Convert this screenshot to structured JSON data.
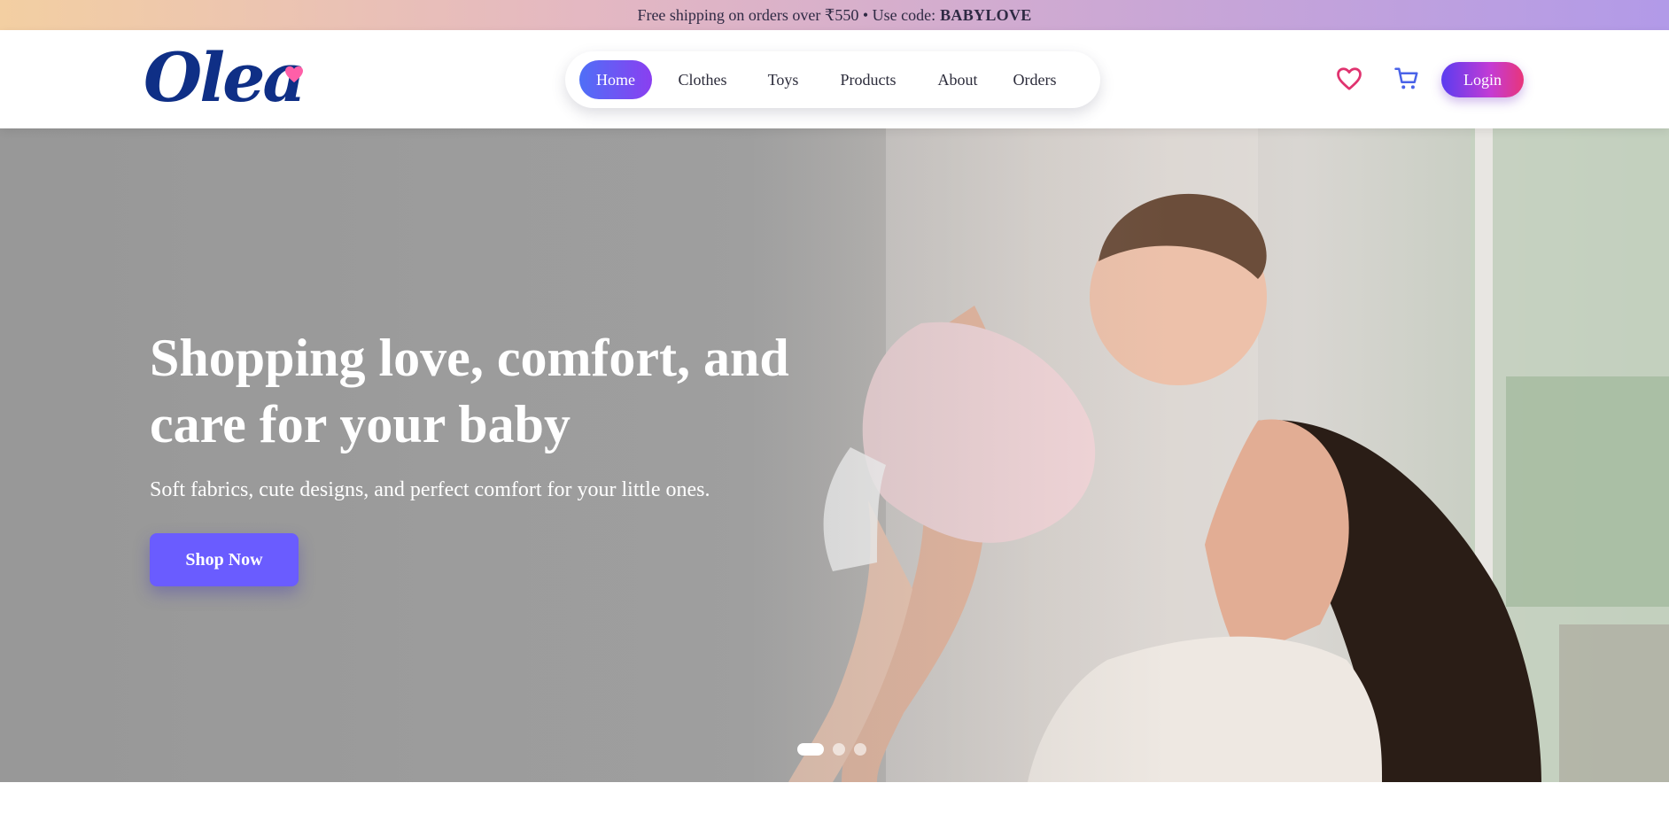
{
  "promo": {
    "text": "Free shipping on orders over ₹550 • Use code:",
    "code": "BABYLOVE"
  },
  "brand": {
    "logo_text": "Olea",
    "logo_color": "#0f2f86",
    "heart_color": "#ff5fa8"
  },
  "nav": {
    "items": [
      {
        "label": "Home",
        "active": true
      },
      {
        "label": "Clothes"
      },
      {
        "label": "Toys"
      },
      {
        "label": "Products"
      },
      {
        "label": "About"
      },
      {
        "label": "Orders"
      }
    ]
  },
  "header_actions": {
    "wishlist_icon": "heart-outline-icon",
    "cart_icon": "shopping-cart-icon",
    "login_label": "Login"
  },
  "hero": {
    "title": "Shopping love, comfort, and care for your baby",
    "subtitle": "Soft fabrics, cute designs, and perfect comfort for your little ones.",
    "cta_label": "Shop Now",
    "cta_color": "#6a5cff",
    "slides": {
      "count": 3,
      "active_index": 0
    }
  }
}
